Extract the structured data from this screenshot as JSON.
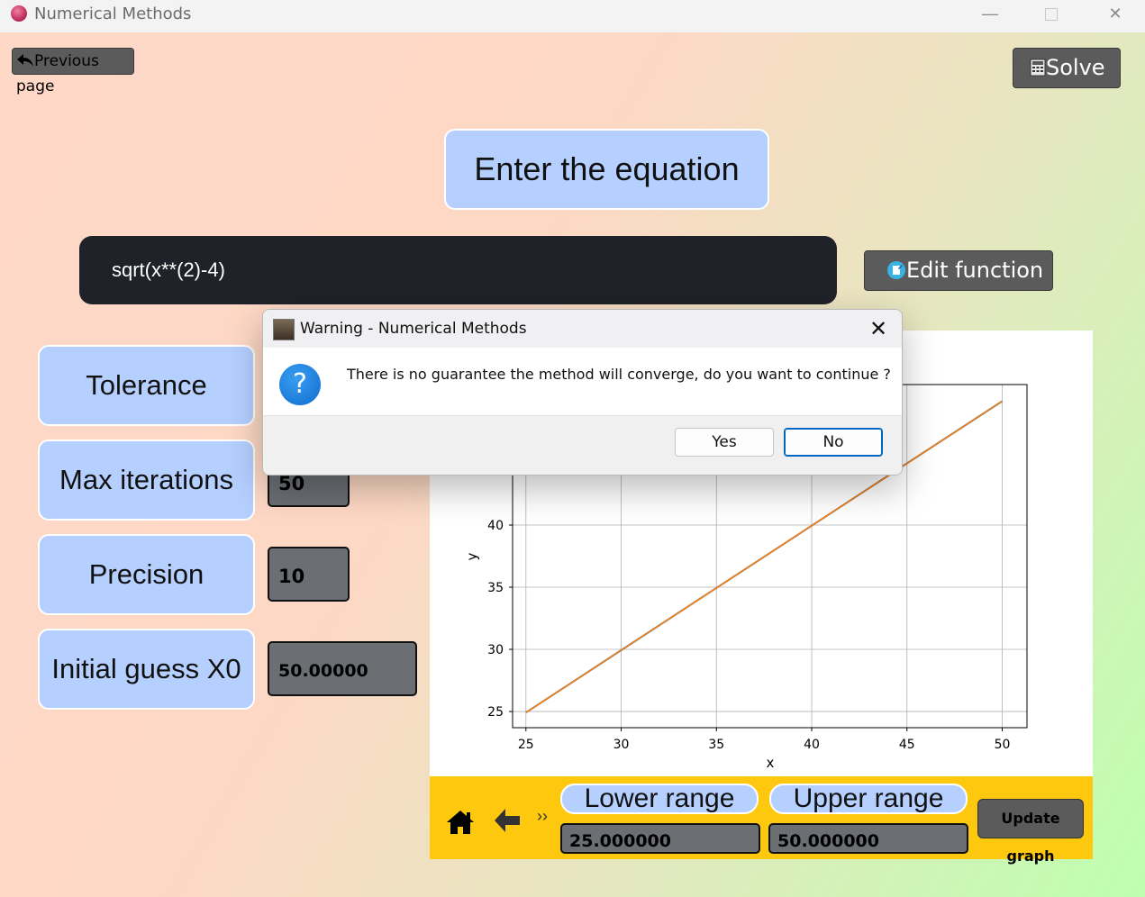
{
  "window": {
    "title": "Numerical Methods",
    "minimize": "—",
    "close": "✕"
  },
  "header": {
    "previous_label": "Previous page",
    "solve_label": "Solve"
  },
  "equation": {
    "title": "Enter the equation",
    "value": "sqrt(x**(2)-4)",
    "edit_label": "Edit function"
  },
  "params": [
    {
      "label": "Tolerance",
      "value": ""
    },
    {
      "label": "Max iterations",
      "value": "50"
    },
    {
      "label": "Precision",
      "value": "10"
    },
    {
      "label": "Initial guess X0",
      "value": "50.00000"
    }
  ],
  "chart_data": {
    "type": "line",
    "title": "",
    "xlabel": "x",
    "ylabel": "y",
    "xlim": [
      24.3,
      51.3
    ],
    "ylim": [
      23.7,
      51.3
    ],
    "xticks": [
      25,
      30,
      35,
      40,
      45,
      50
    ],
    "yticks": [
      25,
      30,
      35,
      40
    ],
    "grid": true,
    "series": [
      {
        "x": [
          25,
          30,
          35,
          40,
          45,
          50
        ],
        "y": [
          24.92,
          29.93,
          34.94,
          39.95,
          44.96,
          49.96
        ],
        "color": "#1f77b4"
      },
      {
        "x": [
          25,
          30,
          35,
          40,
          45,
          50
        ],
        "y": [
          24.92,
          29.93,
          34.94,
          39.95,
          44.96,
          49.96
        ],
        "color": "#ff7f0e"
      }
    ]
  },
  "toolbar": {
    "more_glyph": "››",
    "lower_label": "Lower range",
    "lower_value": "25.000000",
    "upper_label": "Upper range",
    "upper_value": "50.000000",
    "update_label": "Update graph"
  },
  "dialog": {
    "title": "Warning - Numerical Methods",
    "message": "There is no guarantee the method will converge, do you want to continue ?",
    "question_glyph": "?",
    "yes_label": "Yes",
    "no_label": "No",
    "close_glyph": "✕"
  }
}
